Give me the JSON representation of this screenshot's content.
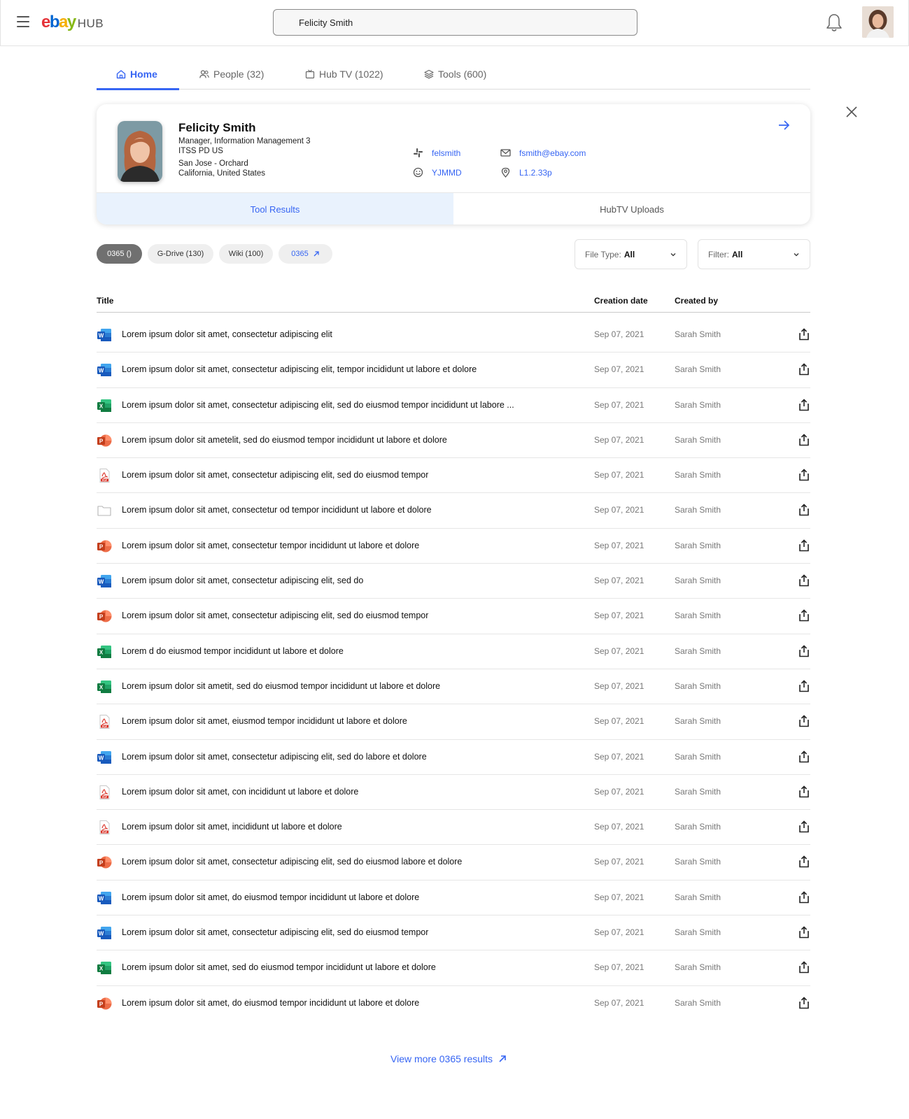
{
  "header": {
    "logo_letters": [
      "e",
      "b",
      "a",
      "y"
    ],
    "logo_suffix": "HUB",
    "search_value": "Felicity Smith",
    "icons": [
      "menu-icon",
      "search-icon",
      "bell-icon",
      "user-avatar"
    ]
  },
  "tabs": [
    {
      "label": "Home",
      "icon": "home-icon",
      "active": true
    },
    {
      "label": "People (32)",
      "icon": "people-icon",
      "active": false
    },
    {
      "label": "Hub TV (1022)",
      "icon": "tv-icon",
      "active": false
    },
    {
      "label": "Tools (600)",
      "icon": "layers-icon",
      "active": false
    }
  ],
  "profile": {
    "name": "Felicity Smith",
    "title": "Manager, Information Management 3",
    "org": "ITSS PD US",
    "location_line1": "San Jose - Orchard",
    "location_line2": "California, United States",
    "slack": "felsmith",
    "email": "fsmith@ebay.com",
    "id": "YJMMD",
    "desk": "L1.2.33p",
    "tabs": [
      {
        "label": "Tool Results",
        "active": true
      },
      {
        "label": "HubTV Uploads",
        "active": false
      }
    ]
  },
  "chips": [
    {
      "label": "0365 ()",
      "active": true
    },
    {
      "label": "G-Drive (130)",
      "active": false
    },
    {
      "label": "Wiki (100)",
      "active": false
    },
    {
      "label": "0365",
      "link": true
    }
  ],
  "filters": {
    "file_type_label": "File Type:",
    "file_type_value": "All",
    "filter_label": "Filter:",
    "filter_value": "All"
  },
  "table": {
    "columns": [
      "Title",
      "Creation date",
      "Created by"
    ],
    "rows": [
      {
        "type": "word",
        "title": "Lorem ipsum dolor sit amet, consectetur adipiscing elit",
        "date": "Sep 07, 2021",
        "by": "Sarah Smith"
      },
      {
        "type": "word",
        "title": "Lorem ipsum dolor sit amet, consectetur adipiscing elit, tempor incididunt ut labore et dolore",
        "date": "Sep 07, 2021",
        "by": "Sarah Smith"
      },
      {
        "type": "excel",
        "title": "Lorem ipsum dolor sit amet, consectetur adipiscing elit, sed do eiusmod tempor incididunt ut labore ...",
        "date": "Sep 07, 2021",
        "by": "Sarah Smith"
      },
      {
        "type": "ppt",
        "title": "Lorem ipsum dolor sit ametelit, sed do eiusmod tempor incididunt ut labore et dolore",
        "date": "Sep 07, 2021",
        "by": "Sarah Smith"
      },
      {
        "type": "pdf",
        "title": "Lorem ipsum dolor sit amet, consectetur adipiscing elit, sed do eiusmod tempor",
        "date": "Sep 07, 2021",
        "by": "Sarah Smith"
      },
      {
        "type": "folder",
        "title": "Lorem ipsum dolor sit amet, consectetur od tempor incididunt ut labore et dolore",
        "date": "Sep 07, 2021",
        "by": "Sarah Smith"
      },
      {
        "type": "ppt",
        "title": "Lorem ipsum dolor sit amet, consectetur  tempor incididunt ut labore et dolore",
        "date": "Sep 07, 2021",
        "by": "Sarah Smith"
      },
      {
        "type": "word",
        "title": "Lorem ipsum dolor sit amet, consectetur adipiscing elit, sed do",
        "date": "Sep 07, 2021",
        "by": "Sarah Smith"
      },
      {
        "type": "ppt",
        "title": "Lorem ipsum dolor sit amet, consectetur adipiscing elit, sed do eiusmod tempor",
        "date": "Sep 07, 2021",
        "by": "Sarah Smith"
      },
      {
        "type": "excel",
        "title": "Lorem d do eiusmod tempor incididunt ut labore et dolore",
        "date": "Sep 07, 2021",
        "by": "Sarah Smith"
      },
      {
        "type": "excel",
        "title": "Lorem ipsum dolor sit ametit, sed do eiusmod tempor incididunt ut labore et dolore",
        "date": "Sep 07, 2021",
        "by": "Sarah Smith"
      },
      {
        "type": "pdf",
        "title": "Lorem ipsum dolor sit amet,  eiusmod tempor incididunt ut labore et dolore",
        "date": "Sep 07, 2021",
        "by": "Sarah Smith"
      },
      {
        "type": "word",
        "title": "Lorem ipsum dolor sit amet, consectetur adipiscing elit, sed do labore et dolore",
        "date": "Sep 07, 2021",
        "by": "Sarah Smith"
      },
      {
        "type": "pdf",
        "title": "Lorem ipsum dolor sit amet, con incididunt ut labore et dolore",
        "date": "Sep 07, 2021",
        "by": "Sarah Smith"
      },
      {
        "type": "pdf",
        "title": "Lorem ipsum dolor sit amet,  incididunt ut labore et dolore",
        "date": "Sep 07, 2021",
        "by": "Sarah Smith"
      },
      {
        "type": "ppt",
        "title": "Lorem ipsum dolor sit amet, consectetur adipiscing elit, sed do eiusmod  labore et dolore",
        "date": "Sep 07, 2021",
        "by": "Sarah Smith"
      },
      {
        "type": "word",
        "title": "Lorem ipsum dolor sit amet,  do eiusmod tempor incididunt ut labore et dolore",
        "date": "Sep 07, 2021",
        "by": "Sarah Smith"
      },
      {
        "type": "word",
        "title": "Lorem ipsum dolor sit amet, consectetur adipiscing elit, sed do eiusmod tempor",
        "date": "Sep 07, 2021",
        "by": "Sarah Smith"
      },
      {
        "type": "excel",
        "title": "Lorem ipsum dolor sit amet, sed do eiusmod tempor incididunt ut labore et dolore",
        "date": "Sep 07, 2021",
        "by": "Sarah Smith"
      },
      {
        "type": "ppt",
        "title": "Lorem ipsum dolor sit amet, do eiusmod tempor incididunt ut labore et dolore",
        "date": "Sep 07, 2021",
        "by": "Sarah Smith"
      }
    ]
  },
  "view_more": "View more 0365 results",
  "colors": {
    "accent": "#3665f3",
    "active_tab_bg": "#e9f2fd",
    "word": "#185abd",
    "excel": "#107c41",
    "ppt": "#d24726",
    "pdf": "#d93025"
  }
}
